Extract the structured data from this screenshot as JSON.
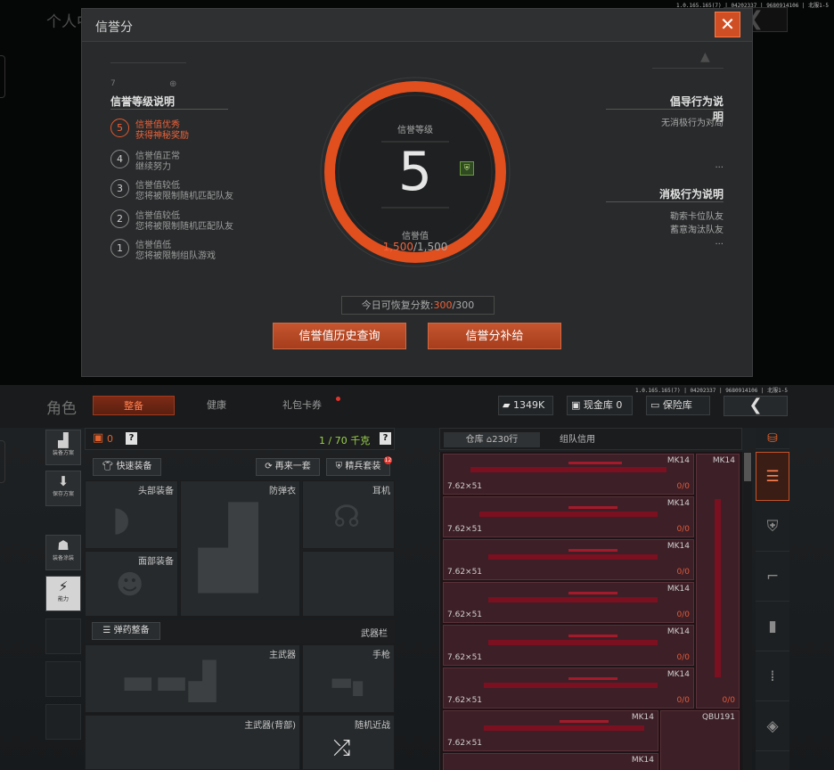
{
  "version_top": "1.0.165.165(7) | 04202337 | 9680914106 | 北服1-5",
  "version_bottom": "1.0.165.165(7) | 04202337 | 9680914106 | 北服1-5",
  "background": {
    "title": "个人中心"
  },
  "dialog": {
    "title": "信誉分",
    "close_icon": "close-icon",
    "left_section_title": "信誉等级说明",
    "levels": [
      {
        "num": "5",
        "line1": "信誉值优秀",
        "line2": "获得神秘奖励",
        "active": true
      },
      {
        "num": "4",
        "line1": "信誉值正常",
        "line2": "继续努力",
        "active": false
      },
      {
        "num": "3",
        "line1": "信誉值较低",
        "line2": "您将被限制随机匹配队友",
        "active": false
      },
      {
        "num": "2",
        "line1": "信誉值较低",
        "line2": "您将被限制随机匹配队友",
        "active": false
      },
      {
        "num": "1",
        "line1": "信誉值低",
        "line2": "您将被限制组队游戏",
        "active": false
      }
    ],
    "dial": {
      "label": "信誉等级",
      "level": "5",
      "score_label": "信誉值",
      "current": "1,500",
      "max": "/1,500",
      "score_fraction": 1.0
    },
    "right_sections": [
      {
        "title": "倡导行为说明",
        "items": [
          "无消极行为对局",
          "..."
        ]
      },
      {
        "title": "消极行为说明",
        "items": [
          "勒索卡位队友",
          "蓄意淘汰队友",
          "..."
        ]
      }
    ],
    "recover": {
      "label": "今日可恢复分数:",
      "current": "300",
      "max": "/300"
    },
    "buttons": {
      "history": "信誉值历史查询",
      "supplement": "信誉分补给"
    }
  },
  "bottom": {
    "title": "角色",
    "tabs": [
      "整备",
      "健康",
      "礼包卡券"
    ],
    "selected_tab": 0,
    "currency": {
      "money": "1349K",
      "cash": "现金库 0",
      "vault": "保险库"
    },
    "side_buttons": [
      "装备方案",
      "保存方案",
      "装备涂装",
      "能力"
    ],
    "loadout": {
      "count": "0",
      "help": "?",
      "weight": "1 / 70 千克",
      "help2": "?"
    },
    "actions": {
      "quick": "快速装备",
      "again": "再来一套",
      "elite": "精兵套装",
      "elite_badge": "12"
    },
    "slots": {
      "head": "头部装备",
      "armor": "防弹衣",
      "ear": "耳机",
      "face": "面部装备"
    },
    "ammo": {
      "button": "弹药整备",
      "label": "武器栏"
    },
    "weapon_slots": {
      "primary": "主武器",
      "pistol": "手枪",
      "primary_back": "主武器(背部)",
      "melee": "随机近战"
    },
    "storage": {
      "tab1": "仓库",
      "rows": "230行",
      "tab2": "组队信用"
    },
    "grid_items": [
      {
        "name": "MK14",
        "caliber": "7.62×51",
        "dur": "0/0"
      },
      {
        "name": "MK14",
        "caliber": "7.62×51",
        "dur": "0/0"
      },
      {
        "name": "MK14",
        "caliber": "7.62×51",
        "dur": "0/0"
      },
      {
        "name": "MK14",
        "caliber": "7.62×51",
        "dur": "0/0"
      },
      {
        "name": "MK14",
        "caliber": "7.62×51",
        "dur": "0/0"
      },
      {
        "name": "MK14",
        "caliber": "7.62×51",
        "dur": "0/0"
      },
      {
        "name": "MK14",
        "caliber": "7.62×51",
        "dur": ""
      },
      {
        "name": "MK14",
        "caliber": "",
        "dur": ""
      }
    ],
    "tall_items": [
      {
        "name": "MK14",
        "dur": "0/0"
      },
      {
        "name": "QBU191",
        "dur": ""
      }
    ]
  }
}
